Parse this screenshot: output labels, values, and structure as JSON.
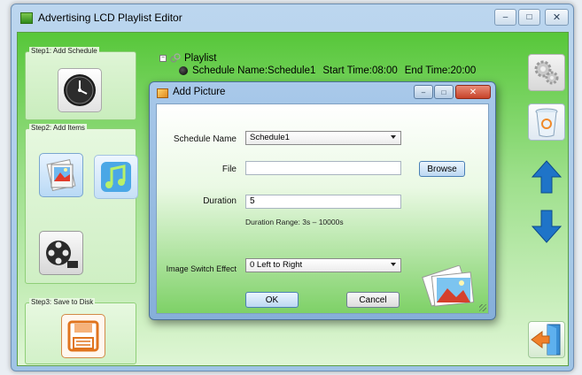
{
  "window": {
    "title": "Advertising LCD Playlist Editor",
    "controls": {
      "minimize": "–",
      "maximize": "□",
      "close": "✕"
    }
  },
  "steps": {
    "step1": {
      "label": "Step1: Add Schedule",
      "button_icon": "clock-icon"
    },
    "step2": {
      "label": "Step2: Add Items",
      "button_icons": [
        "picture-icon",
        "music-icon",
        "video-icon"
      ]
    },
    "step3": {
      "label": "Step3: Save to Disk",
      "button_icon": "floppy-disk-icon"
    }
  },
  "tree": {
    "root": "Playlist",
    "schedule_name": "Schedule Name:Schedule1",
    "start_time": "Start Time:08:00",
    "end_time": "End Time:20:00"
  },
  "right_toolbar": [
    "settings-icon",
    "recycle-bin-icon",
    "move-up-icon",
    "move-down-icon",
    "exit-icon"
  ],
  "dialog": {
    "title": "Add Picture",
    "controls": {
      "minimize": "–",
      "maximize": "□",
      "close": "✕"
    },
    "schedule_label": "Schedule Name",
    "schedule_value": "Schedule1",
    "file_label": "File",
    "file_value": "",
    "browse_label": "Browse",
    "duration_label": "Duration",
    "duration_value": "5",
    "duration_hint": "Duration Range: 3s – 10000s",
    "effect_label": "Image Switch Effect",
    "effect_value": "0 Left to Right",
    "ok_label": "OK",
    "cancel_label": "Cancel"
  },
  "colors": {
    "client_green": "#57c73a",
    "title_blue": "#bcd6ef",
    "arrow_blue": "#1f74c8",
    "exit_orange": "#f0802a"
  }
}
